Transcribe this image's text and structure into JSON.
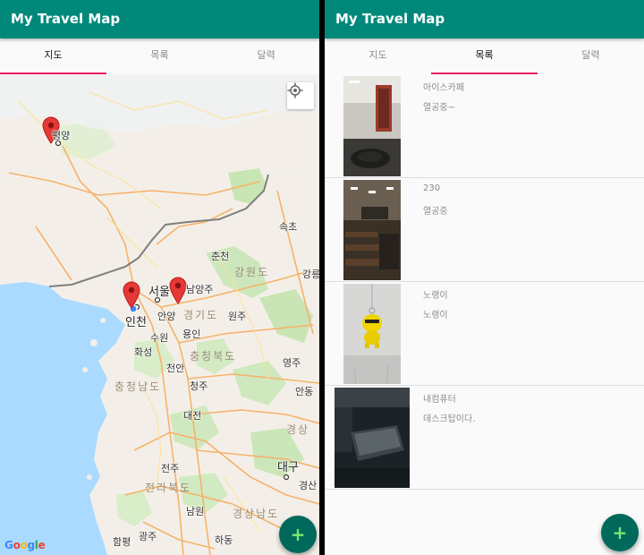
{
  "app": {
    "title": "My Travel Map"
  },
  "tabs": [
    {
      "label": "지도"
    },
    {
      "label": "목록"
    },
    {
      "label": "달력"
    }
  ],
  "colors": {
    "appbar": "#00897b",
    "tab_indicator": "#e91e63",
    "fab": "#00695c",
    "fab_icon": "#7be86f",
    "marker": "#e53935"
  },
  "map": {
    "attribution": [
      "G",
      "o",
      "o",
      "g",
      "l",
      "e"
    ],
    "markers": 3,
    "labels": {
      "pyongyang": "평양",
      "sokcho": "속초",
      "chuncheon": "춘천",
      "gangwon": "강원도",
      "gangneung": "강릉",
      "seoul": "서울",
      "namyangju": "남양주",
      "incheon": "인천",
      "anyang": "안양",
      "gyeonggi": "경기도",
      "wonju": "원주",
      "suwon": "수원",
      "yongin": "용인",
      "hwaseong": "화성",
      "chungbuk": "충청북도",
      "yeongju": "영주",
      "cheonan": "천안",
      "chungnam": "충청남도",
      "cheongju": "청주",
      "andong": "안동",
      "daejeon": "대전",
      "gyeongsang": "경상",
      "jeonju": "전주",
      "daegu": "대구",
      "jeonbuk": "전라북도",
      "gyeongsan": "경산",
      "namwon": "남원",
      "gyeongnam": "경상남도",
      "hampyeong": "함평",
      "gwangju": "광주",
      "hadong": "하동"
    }
  },
  "list": {
    "items": [
      {
        "title": "아이스카페",
        "desc": "열공중~"
      },
      {
        "title": "230",
        "desc": "열공중"
      },
      {
        "title": "노랭이",
        "desc": "노랭이"
      },
      {
        "title": "내컴퓨터",
        "desc": "데스크탑이다."
      }
    ]
  },
  "fab": {
    "icon": "+"
  }
}
